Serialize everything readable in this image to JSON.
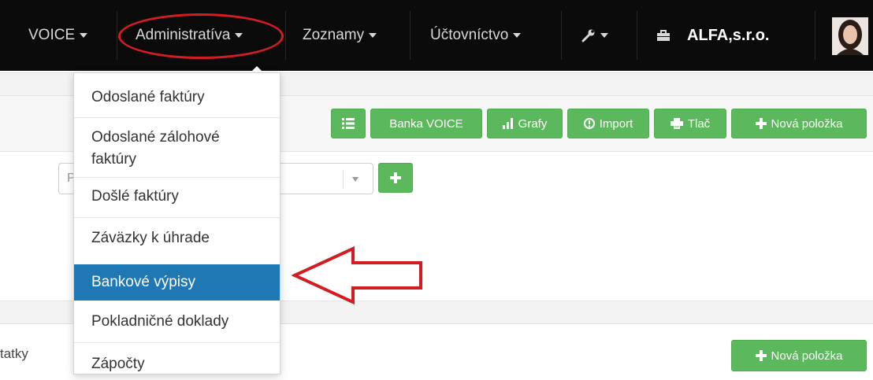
{
  "navbar": {
    "items": [
      "VOICE",
      "Administratíva",
      "Zoznamy",
      "Účtovníctvo"
    ],
    "company": "ALFA,s.r.o."
  },
  "toolbar": {
    "list_icon": "list-icon",
    "bank_label": "Banka VOICE",
    "charts_label": "Grafy",
    "import_label": "Import",
    "print_label": "Tlač",
    "new_item_label": "Nová položka"
  },
  "filter": {
    "placeholder": "P"
  },
  "dropdown": {
    "items": [
      "Odoslané faktúry",
      "Odoslané zálohové faktúry",
      "Došlé faktúry",
      "Záväzky k úhrade",
      "Bankové výpisy",
      "Pokladničné doklady",
      "Zápočty"
    ],
    "active_index": 4
  },
  "lower": {
    "partial_label": "tatky",
    "new_item_label": "Nová položka"
  },
  "colors": {
    "navbar": "#0b0b0b",
    "button_green": "#5cb85c",
    "active_item": "#1f78b4",
    "annotation_red": "#d21e23"
  }
}
